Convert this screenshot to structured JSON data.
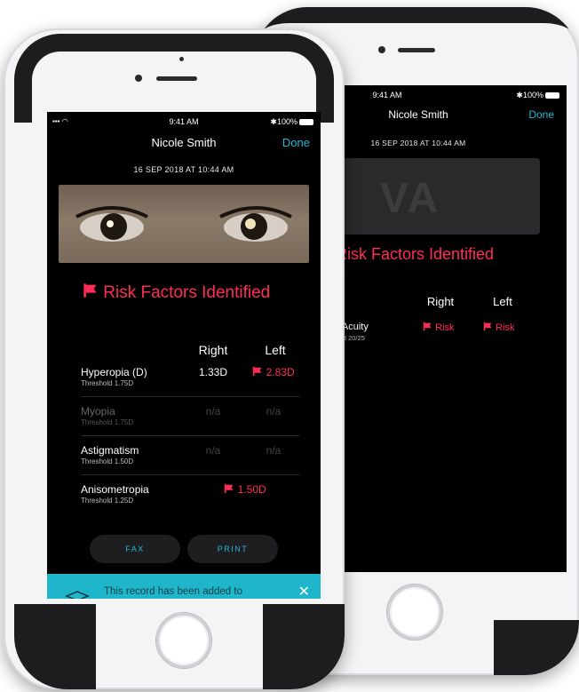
{
  "back_phone": {
    "status": {
      "time": "9:41 AM",
      "battery": "100%"
    },
    "nav": {
      "title": "Nicole Smith",
      "done_label": "Done"
    },
    "date": "16 SEP 2018 AT 10:44 AM",
    "banner_text": "VA",
    "risk_title": "Risk Factors Identified",
    "columns": {
      "right": "Right",
      "left": "Left"
    },
    "row": {
      "name": "l Acuity",
      "threshold": "old 20/25",
      "right": "Risk",
      "left": "Risk"
    }
  },
  "front_phone": {
    "status": {
      "time": "9:41 AM",
      "battery": "100%"
    },
    "nav": {
      "title": "Nicole Smith",
      "done_label": "Done"
    },
    "date": "16 SEP 2018 AT 10:44 AM",
    "risk_title": "Risk Factors Identified",
    "columns": {
      "right": "Right",
      "left": "Left"
    },
    "rows": [
      {
        "name": "Hyperopia (D)",
        "threshold": "Threshold 1.75D",
        "right": "1.33D",
        "left": "2.83D"
      },
      {
        "name": "Myopia",
        "threshold": "Threshold 1.75D",
        "right": "n/a",
        "left": "n/a"
      },
      {
        "name": "Astigmatism",
        "threshold": "Threshold 1.50D",
        "right": "n/a",
        "left": "n/a"
      },
      {
        "name": "Anisometropia",
        "threshold": "Threshold 1.25D",
        "combined": "1.50D"
      }
    ],
    "buttons": {
      "fax": "FAX",
      "print": "PRINT"
    },
    "toast": {
      "message": "This record has been added to the patient's EHR"
    }
  },
  "colors": {
    "accent": "#22b7d4",
    "risk_red": "#ff2d55",
    "toast_bg": "#1fb6cc"
  }
}
